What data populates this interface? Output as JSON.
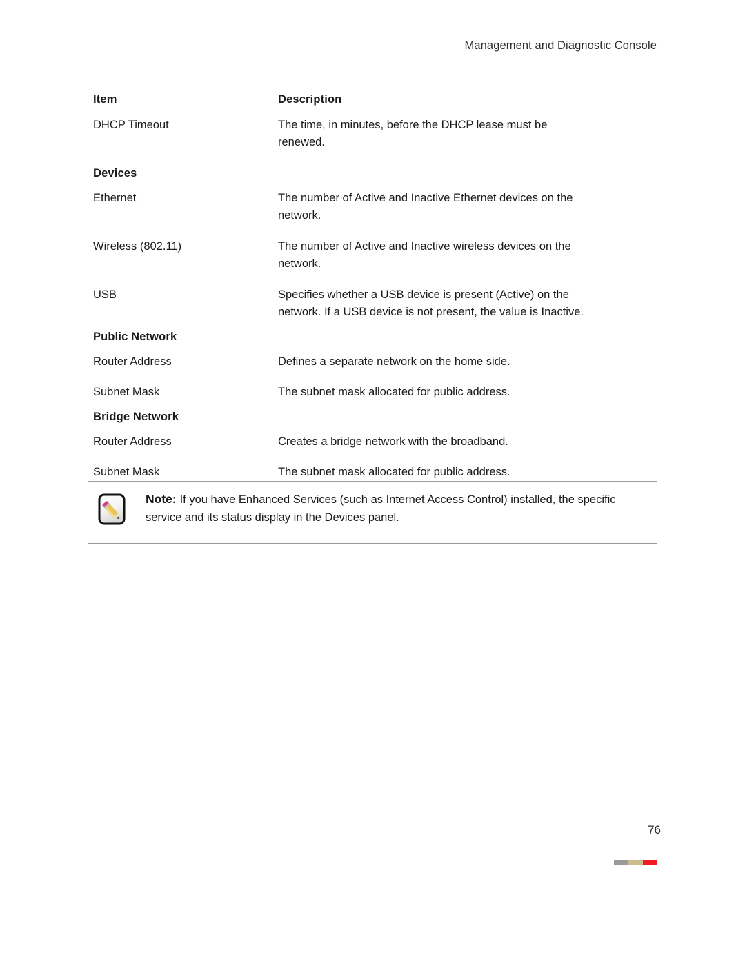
{
  "header": {
    "title": "Management and Diagnostic Console"
  },
  "table": {
    "columns": {
      "item": "Item",
      "description": "Description"
    },
    "rows": [
      {
        "type": "row",
        "item": "DHCP Timeout",
        "description": "The time, in minutes, before the DHCP lease must be renewed."
      },
      {
        "type": "heading",
        "item": "Devices"
      },
      {
        "type": "row",
        "item": "Ethernet",
        "description": "The number of Active and Inactive Ethernet devices on the network."
      },
      {
        "type": "row",
        "item": "Wireless (802.11)",
        "description": "The number of Active and Inactive wireless devices on the network."
      },
      {
        "type": "row",
        "item": "USB",
        "description": "Specifies whether a USB device is present (Active) on the network. If a USB device is not present, the value is Inactive."
      },
      {
        "type": "heading",
        "item": "Public Network"
      },
      {
        "type": "row",
        "item": "Router Address",
        "description": "Defines a separate network on the home side."
      },
      {
        "type": "row",
        "item": "Subnet Mask",
        "description": "The subnet mask allocated for public address."
      },
      {
        "type": "heading",
        "item": "Bridge Network"
      },
      {
        "type": "row",
        "item": "Router Address",
        "description": "Creates a bridge network with the broadband."
      },
      {
        "type": "row",
        "item": "Subnet Mask",
        "description": "The subnet mask allocated for public address."
      }
    ]
  },
  "note": {
    "icon": "pencil-note-icon",
    "label": "Note:",
    "text": "If you have Enhanced Services (such as Internet Access Control) installed, the specific service and its status display in the Devices panel."
  },
  "footer": {
    "page_number": "76",
    "bar_colors": {
      "gray": "#9a9a9a",
      "tan": "#cbbd8f",
      "red": "#ed1c24"
    }
  }
}
